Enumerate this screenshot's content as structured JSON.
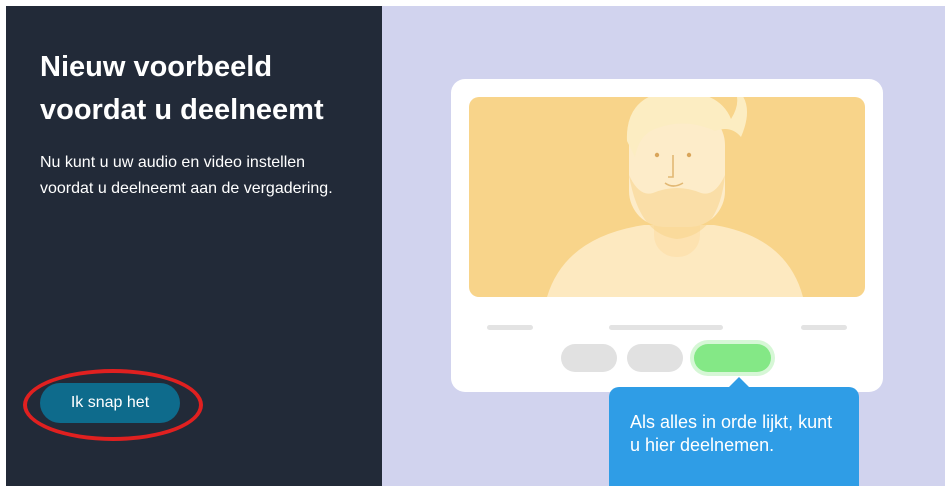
{
  "dialog": {
    "title": "Nieuw voorbeeld voordat u deelneemt",
    "description": "Nu kunt u uw audio en video instellen voordat u deelneemt aan de vergadering.",
    "confirm_button": "Ik snap het"
  },
  "illustration": {
    "tooltip": "Als alles in orde lijkt, kunt u hier deelnemen."
  },
  "colors": {
    "left_panel": "#222a38",
    "right_panel": "#d1d3ee",
    "button": "#0e6b8c",
    "highlight_ring": "#e02020",
    "tooltip": "#2f9de6",
    "video_background": "#f8d48a",
    "join_pill": "#84e886"
  }
}
